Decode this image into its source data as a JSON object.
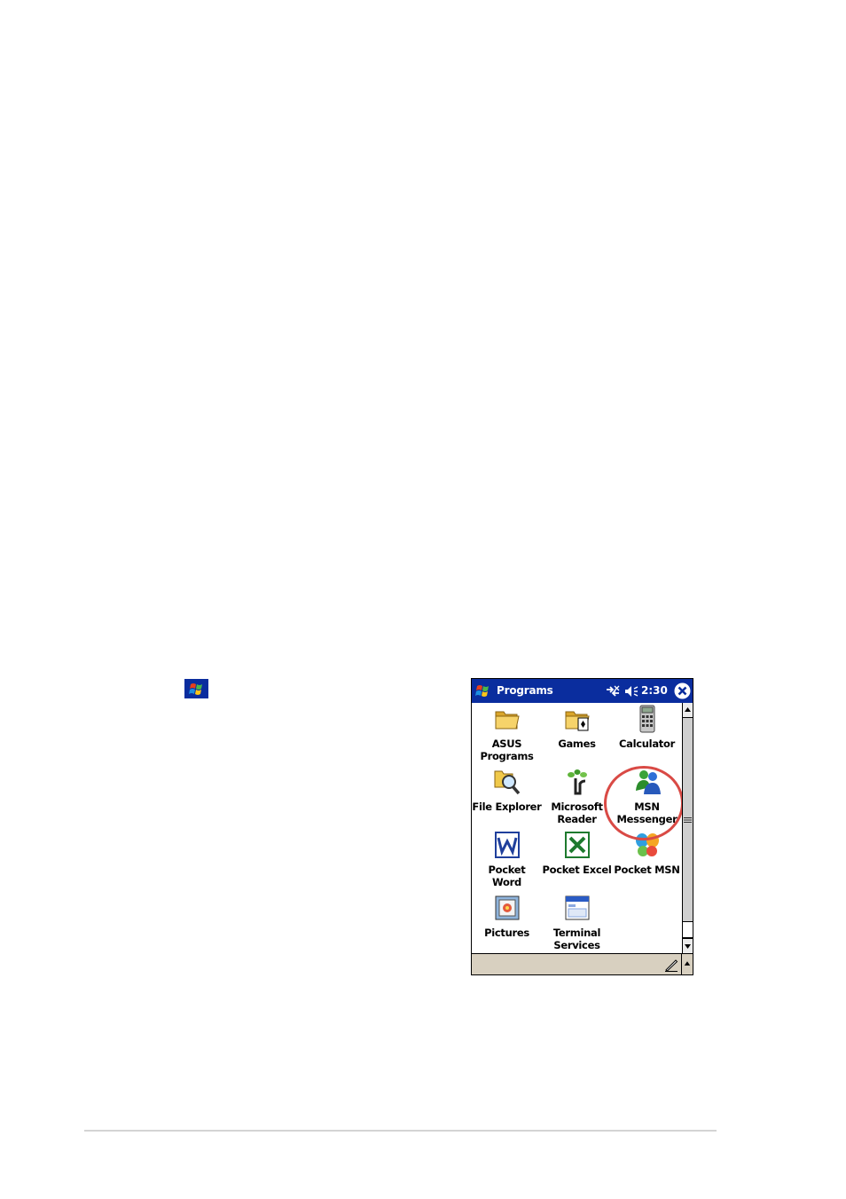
{
  "titlebar": {
    "title": "Programs",
    "time": "2:30"
  },
  "programs": [
    {
      "label_line1": "ASUS",
      "label_line2": "Programs",
      "icon": "folder-icon"
    },
    {
      "label_line1": "Games",
      "label_line2": "",
      "icon": "games-folder-icon"
    },
    {
      "label_line1": "Calculator",
      "label_line2": "",
      "icon": "calculator-icon"
    },
    {
      "label_line1": "File Explorer",
      "label_line2": "",
      "icon": "file-explorer-icon"
    },
    {
      "label_line1": "Microsoft",
      "label_line2": "Reader",
      "icon": "reader-icon"
    },
    {
      "label_line1": "MSN",
      "label_line2": "Messenger",
      "icon": "msn-messenger-icon"
    },
    {
      "label_line1": "Pocket",
      "label_line2": "Word",
      "icon": "word-icon"
    },
    {
      "label_line1": "Pocket Excel",
      "label_line2": "",
      "icon": "excel-icon"
    },
    {
      "label_line1": "Pocket MSN",
      "label_line2": "",
      "icon": "msn-butterfly-icon"
    },
    {
      "label_line1": "Pictures",
      "label_line2": "",
      "icon": "pictures-icon"
    },
    {
      "label_line1": "Terminal",
      "label_line2": "Services",
      "icon": "terminal-services-icon"
    }
  ],
  "colors": {
    "titlebar": "#0a2d9e",
    "highlight_circle": "#d94a45",
    "menubar": "#d8d0c0"
  }
}
